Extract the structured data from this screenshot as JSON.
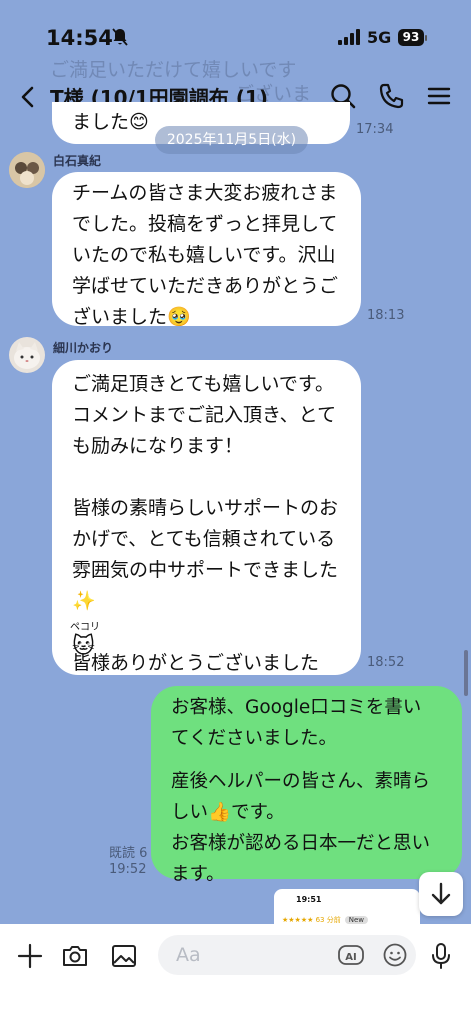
{
  "status_bar": {
    "time": "14:54",
    "network": "5G",
    "battery": "93"
  },
  "header": {
    "title": "T様 (10/1田園調布 (1)"
  },
  "ghost_overlay": {
    "line1": "ご満足いただけて嬉しいです",
    "line2": "ございま"
  },
  "previous_message": {
    "tail": "ました😊",
    "time": "17:34"
  },
  "date_separator": "2025年11月5日(水)",
  "messages": [
    {
      "sender": "白石真紀",
      "lines": [
        "チームの皆さま大変お疲れさま",
        "でした。投稿をずっと拝見して",
        "いたので私も嬉しいです。沢山",
        "学ばせていただきありがとうご",
        "ざいました🥹"
      ],
      "time": "18:13"
    },
    {
      "sender": "細川かおり",
      "lines": [
        "ご満足頂きとても嬉しいです。",
        "コメントまでご記入頂き、とて",
        "も励みになります！",
        "",
        "皆様の素晴らしいサポートのお",
        "かげで、とても信頼されている",
        "雰囲気の中サポートできました",
        "✨",
        "",
        "皆様ありがとうございました",
        "🐱"
      ],
      "sticker_text": "ペコリ",
      "time": "18:52"
    },
    {
      "lines": [
        "お客様、Google口コミを書い",
        "てくださいました。",
        "",
        "産後ヘルパーの皆さん、素晴ら",
        "しい👍です。",
        "お客様が認める日本一だと思い",
        "ます。"
      ],
      "read_label": "既読 6",
      "time": "19:52"
    }
  ],
  "thumbnail": {
    "time": "19:51",
    "meta": "★★★★★ 63 分前",
    "badge": "New"
  },
  "composer": {
    "placeholder": "Aa",
    "ai_label": "AI"
  },
  "icons": {
    "back": "chevron-left-icon",
    "search": "search-icon",
    "call": "phone-icon",
    "menu": "menu-icon",
    "plus": "plus-icon",
    "camera": "camera-icon",
    "image": "image-icon",
    "emoji": "emoji-icon",
    "mic": "mic-icon",
    "scroll_down": "arrow-down-icon"
  }
}
